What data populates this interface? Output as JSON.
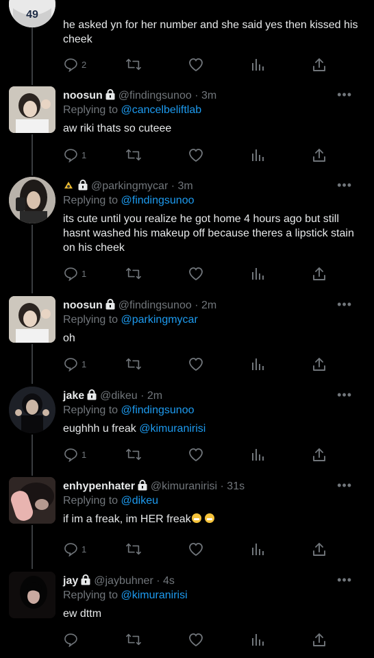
{
  "thread": [
    {
      "avatar": "jersey-avatar",
      "text": "he asked yn for her number and she said yes then kissed his cheek",
      "replies_count": "2"
    },
    {
      "name": "noosun",
      "handle": "@findingsunoo",
      "time": "· 3m",
      "reply_to_prefix": "Replying to",
      "reply_to": "@cancelbeliftlab",
      "text": "aw riki thats so cuteee",
      "replies_count": "1"
    },
    {
      "name": "",
      "handle": "@parkingmycar",
      "time": "· 3m",
      "reply_to_prefix": "Replying to",
      "reply_to": "@findingsunoo",
      "text": "its cute until you realize he got home 4 hours ago but still hasnt washed his makeup off because theres a lipstick stain on his cheek",
      "replies_count": "1"
    },
    {
      "name": "noosun",
      "handle": "@findingsunoo",
      "time": "· 2m",
      "reply_to_prefix": "Replying to",
      "reply_to": "@parkingmycar",
      "text": "oh",
      "replies_count": "1"
    },
    {
      "name": "jake",
      "handle": "@dikeu",
      "time": "· 2m",
      "reply_to_prefix": "Replying to",
      "reply_to": "@findingsunoo",
      "text": "eughhh u freak",
      "mention": "@kimuranirisi",
      "replies_count": "1"
    },
    {
      "name": "enhypenhater",
      "handle": "@kimuranirisi",
      "time": "· 31s",
      "reply_to_prefix": "Replying to",
      "reply_to": "@dikeu",
      "text": "if im a freak, im HER freak",
      "replies_count": "1"
    },
    {
      "name": "jay",
      "handle": "@jaybuhner",
      "time": "· 4s",
      "reply_to_prefix": "Replying to",
      "reply_to": "@kimuranirisi",
      "text": "ew dttm",
      "replies_count": ""
    }
  ],
  "icons": {
    "reply": "reply-icon",
    "retweet": "retweet-icon",
    "like": "heart-icon",
    "views": "views-icon",
    "share": "share-icon",
    "more": "more-icon",
    "lock": "lock-icon"
  },
  "more_glyph": "•••",
  "colors": {
    "background": "#000000",
    "link": "#1d9bf0",
    "muted": "#71767b",
    "text": "#e7e9ea"
  }
}
